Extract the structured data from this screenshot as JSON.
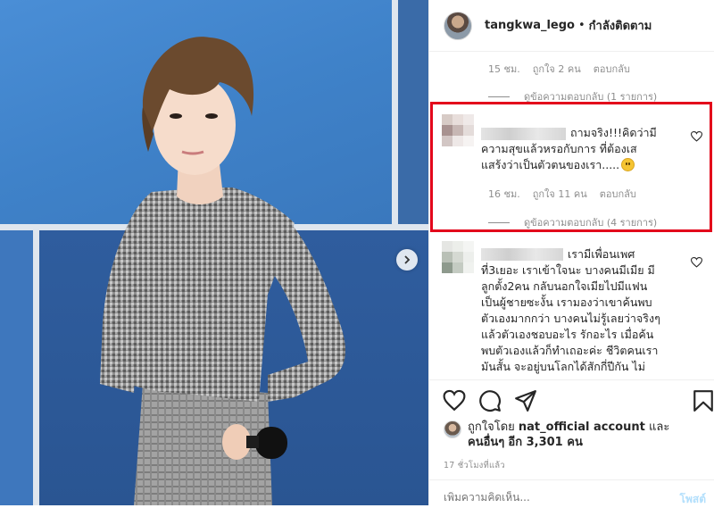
{
  "header": {
    "username": "tangkwa_lego",
    "separator": "•",
    "follow_status": "กำลังติดตาม"
  },
  "comment_prev": {
    "meta": {
      "time": "15 ชม.",
      "likes": "ถูกใจ 2 คน",
      "reply": "ตอบกลับ"
    },
    "view_replies": "ดูข้อความตอบกลับ (1 รายการ)"
  },
  "comment_highlight": {
    "lines": [
      "ถามจริง!!!คิดว่ามี",
      "ความสุขแล้วหรอกับการ ที่ต้องเส",
      "แสร้งว่าเป็นตัวตนของเรา....."
    ],
    "emoji": "smiling-face-emoji",
    "meta": {
      "time": "16 ชม.",
      "likes": "ถูกใจ 11 คน",
      "reply": "ตอบกลับ"
    },
    "view_replies": "ดูข้อความตอบกลับ (4 รายการ)"
  },
  "comment_next": {
    "lines": [
      "เรามีเพื่อนเพศ",
      "ที่3เยอะ เราเข้าใจนะ บางคนมีเมีย มี",
      "ลูกตั้ง2คน กลับนอกใจเมียไปมีแฟน",
      "เป็นผู้ชายซะงั้น เรามองว่าเขาค้นพบ",
      "ตัวเองมากกว่า บางคนไม่รู้เลยว่าจริงๆ",
      "แล้วตัวเองชอบอะไร รักอะไร เมื่อค้น",
      "พบตัวเองแล้วก็ทำเถอะค่ะ ชีวิตคนเรา",
      "มันสั้น จะอยู่บนโลกได้สักกี่ปีกัน ไม่"
    ]
  },
  "likes": {
    "prefix": "ถูกใจโดย",
    "account": "nat_official account",
    "and": "และ",
    "others_label": "คนอื่นๆ",
    "others_count": "อีก 3,301 คน"
  },
  "timestamp": "17 ชั่วโมงที่แล้ว",
  "add_comment": {
    "placeholder": "เพิ่มความคิดเห็น...",
    "post": "โพสต์"
  },
  "icons": {
    "like": "heart-icon",
    "comment": "comment-icon",
    "share": "share-icon",
    "save": "bookmark-icon",
    "next": "chevron-right-icon"
  },
  "colors": {
    "highlight": "#e3061b",
    "muted": "#8e8e8e",
    "link": "#b2dffc"
  }
}
